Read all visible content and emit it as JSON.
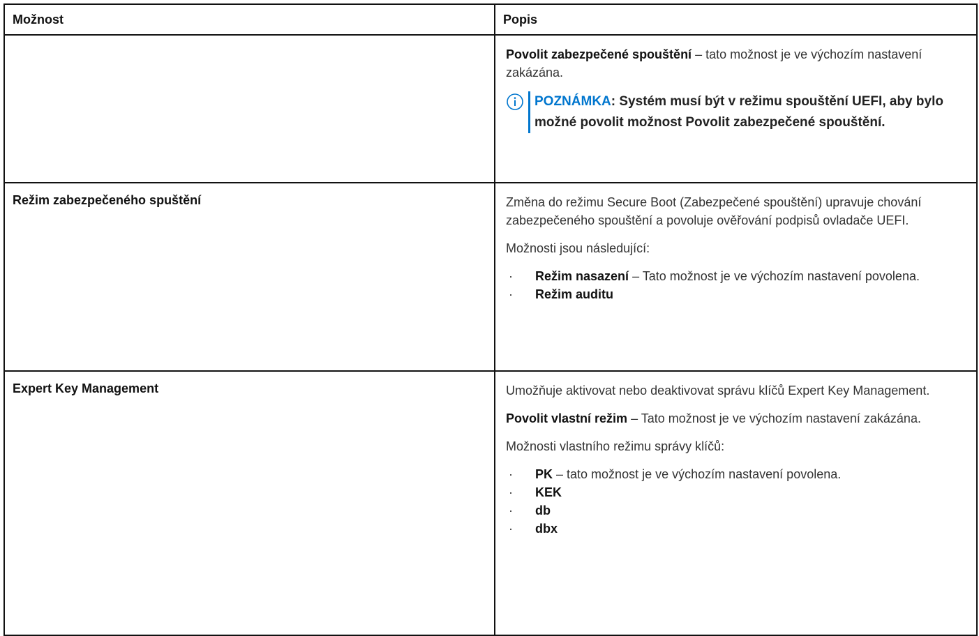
{
  "header": {
    "col1": "Možnost",
    "col2": "Popis"
  },
  "rows": [
    {
      "option": "",
      "para1_bold": "Povolit zabezpečené spouštění",
      "para1_rest": " – tato možnost je ve výchozím nastavení zakázána.",
      "note_label": "POZNÁMKA",
      "note_text": ": Systém musí být v režimu spouštění UEFI, aby bylo možné povolit možnost Povolit zabezpečené spouštění."
    },
    {
      "option": "Režim zabezpečeného spuštění",
      "para1": "Změna do režimu Secure Boot (Zabezpečené spouštění) upravuje chování zabezpečeného spouštění a povoluje ověřování podpisů ovladače UEFI.",
      "para2": "Možnosti jsou následující:",
      "items": [
        {
          "bold": "Režim nasazení",
          "rest": " – Tato možnost je ve výchozím nastavení povolena."
        },
        {
          "bold": "Režim auditu",
          "rest": ""
        }
      ]
    },
    {
      "option": "Expert Key Management",
      "para1": "Umožňuje aktivovat nebo deaktivovat správu klíčů Expert Key Management.",
      "para2_bold": "Povolit vlastní režim",
      "para2_rest": " – Tato možnost je ve výchozím nastavení zakázána.",
      "para3": "Možnosti vlastního režimu správy klíčů:",
      "items": [
        {
          "bold": "PK",
          "rest": " – tato možnost je ve výchozím nastavení povolena."
        },
        {
          "bold": "KEK",
          "rest": ""
        },
        {
          "bold": "db",
          "rest": ""
        },
        {
          "bold": "dbx",
          "rest": ""
        }
      ]
    }
  ],
  "bullet": "·",
  "colors": {
    "note_accent": "#0076ce",
    "border": "#111111",
    "text": "#333333"
  },
  "icons": {
    "note": "info-circle-icon"
  }
}
